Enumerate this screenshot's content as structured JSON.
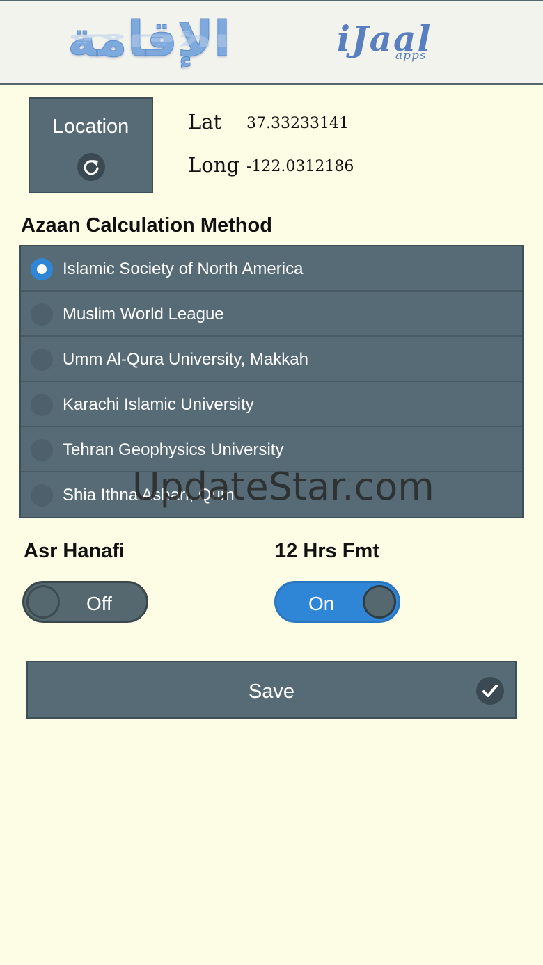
{
  "header": {
    "logo_arabic": "الإقامة",
    "logo_brand": "iJaal",
    "logo_brand_sub": "apps"
  },
  "location": {
    "button_label": "Location",
    "lat_label": "Lat",
    "lat_value": "37.33233141",
    "long_label": "Long",
    "long_value": "-122.0312186"
  },
  "azaan": {
    "title": "Azaan Calculation Method",
    "methods": [
      {
        "label": "Islamic Society of North America",
        "selected": true
      },
      {
        "label": "Muslim World League",
        "selected": false
      },
      {
        "label": "Umm Al-Qura University, Makkah",
        "selected": false
      },
      {
        "label": "Karachi Islamic University",
        "selected": false
      },
      {
        "label": "Tehran Geophysics University",
        "selected": false
      },
      {
        "label": "Shia Ithna Ashari, Qum",
        "selected": false
      }
    ]
  },
  "asr_hanafi": {
    "label": "Asr Hanafi",
    "state": "Off"
  },
  "hrs_fmt": {
    "label": "12 Hrs Fmt",
    "state": "On"
  },
  "save": {
    "label": "Save"
  },
  "watermark": "UpdateStar.com",
  "colors": {
    "background": "#fdfde6",
    "panel": "#576b76",
    "accent": "#2f86d6"
  }
}
